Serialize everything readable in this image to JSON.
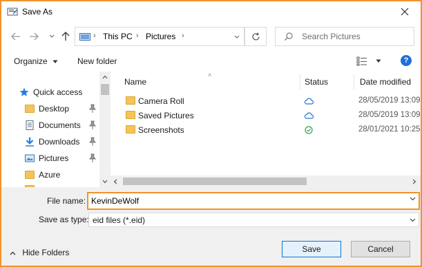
{
  "window": {
    "title": "Save As"
  },
  "address": {
    "crumbs": [
      "This PC",
      "Pictures"
    ]
  },
  "search": {
    "placeholder": "Search Pictures"
  },
  "toolbar": {
    "organize": "Organize",
    "new_folder": "New folder"
  },
  "nav": {
    "items": [
      {
        "label": "Quick access",
        "icon": "star-icon"
      },
      {
        "label": "Desktop",
        "icon": "folder-icon",
        "pinned": true
      },
      {
        "label": "Documents",
        "icon": "documents-icon",
        "pinned": true
      },
      {
        "label": "Downloads",
        "icon": "download-icon",
        "pinned": true
      },
      {
        "label": "Pictures",
        "icon": "pictures-icon",
        "pinned": true
      },
      {
        "label": "Azure",
        "icon": "folder-icon",
        "pinned": false
      }
    ]
  },
  "columns": {
    "name": "Name",
    "status": "Status",
    "date": "Date modified"
  },
  "files": [
    {
      "name": "Camera Roll",
      "status": "cloud",
      "date": "28/05/2019 13:09"
    },
    {
      "name": "Saved Pictures",
      "status": "cloud",
      "date": "28/05/2019 13:09"
    },
    {
      "name": "Screenshots",
      "status": "synced",
      "date": "28/01/2021 10:25"
    }
  ],
  "form": {
    "file_name_label": "File name:",
    "file_name_value": "KevinDeWolf",
    "save_type_label": "Save as type:",
    "save_type_value": "eid files (*.eid)"
  },
  "actions": {
    "hide_folders": "Hide Folders",
    "save": "Save",
    "cancel": "Cancel"
  },
  "colors": {
    "accent_border": "#f0932b",
    "cloud": "#1e73d8",
    "synced": "#2e9e4f",
    "help": "#1e6fd9"
  }
}
